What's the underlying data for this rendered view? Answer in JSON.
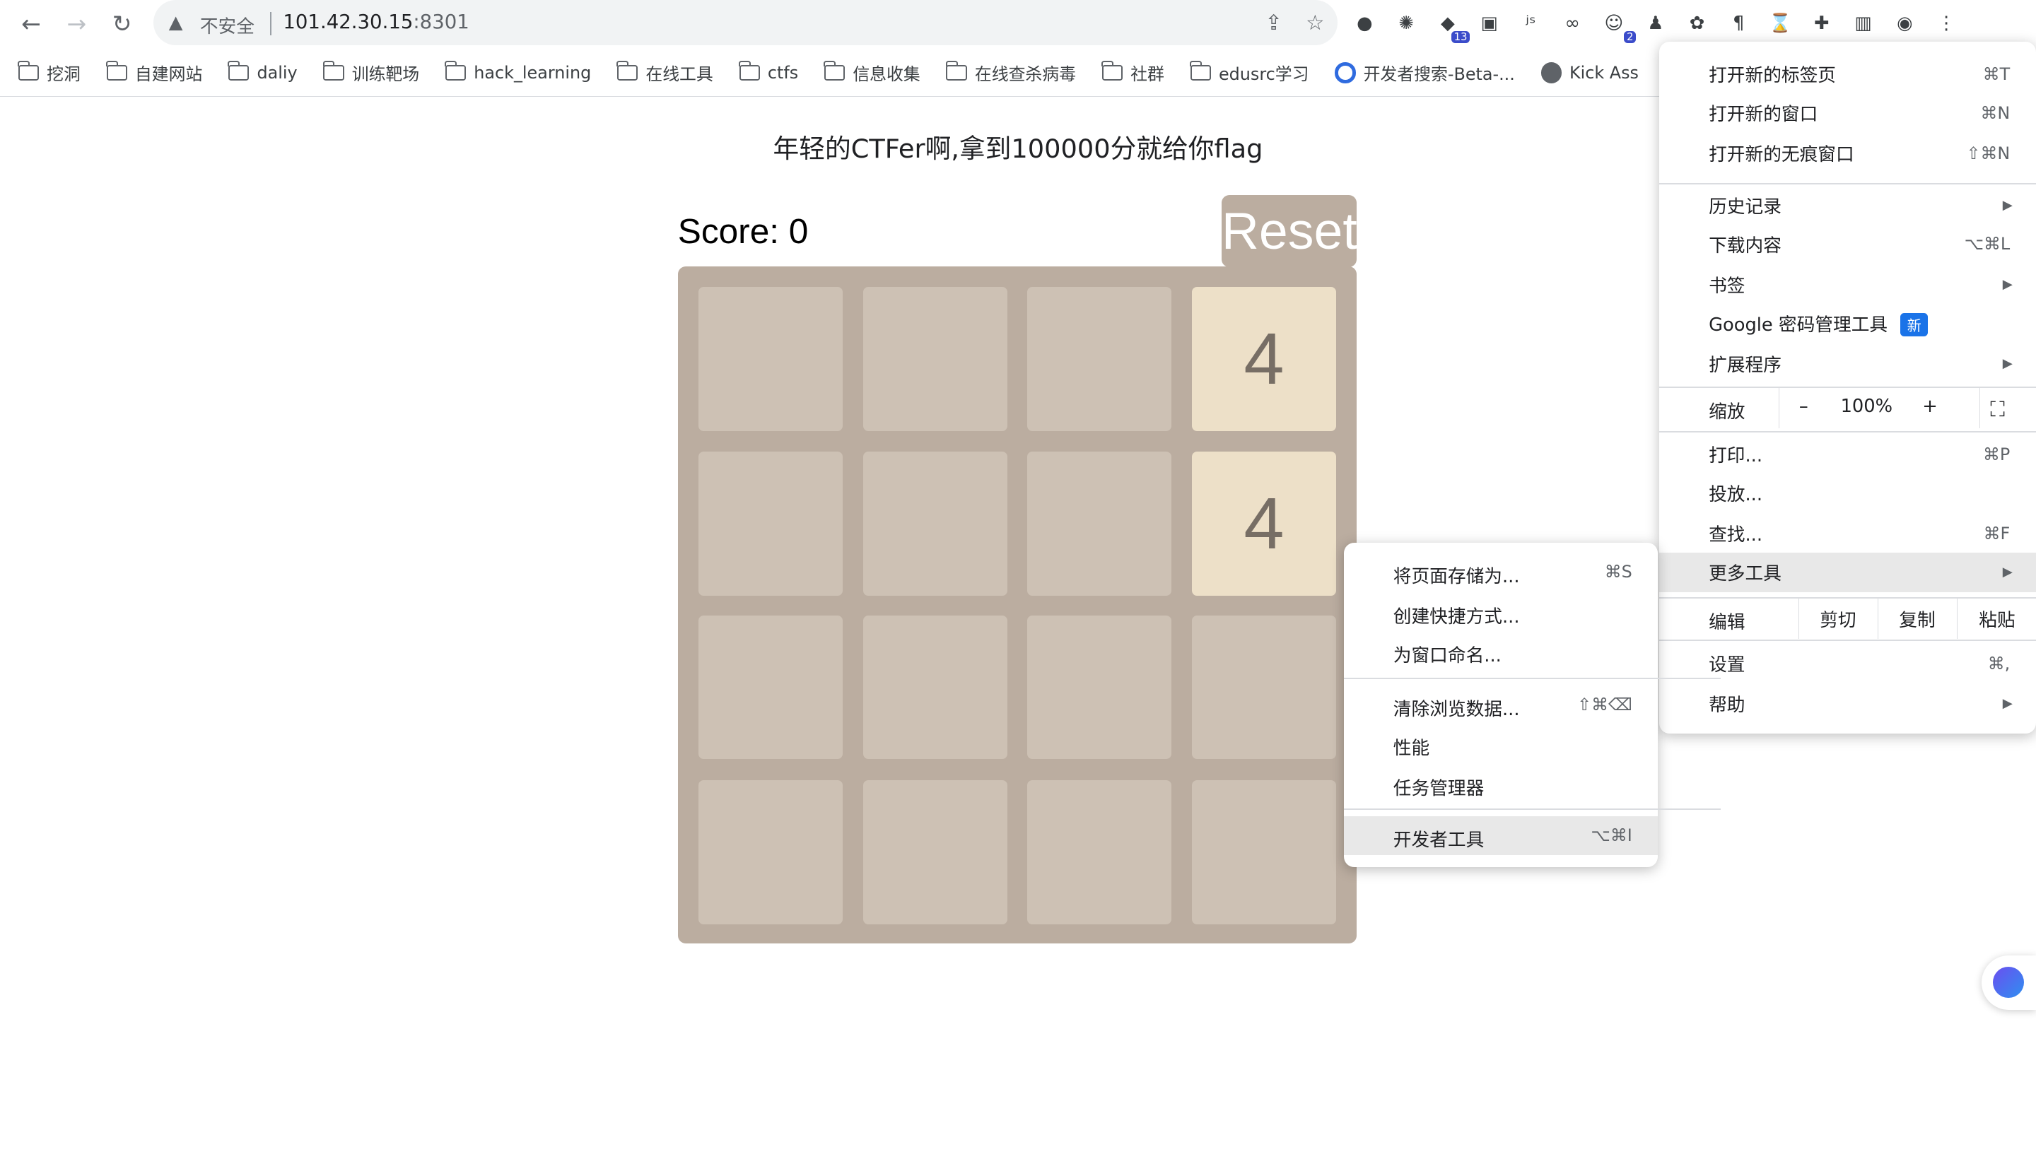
{
  "browser": {
    "security_label": "不安全",
    "url_host": "101.42.30.15",
    "url_port": ":8301",
    "extensions": [
      {
        "icon": "circle-icon",
        "badge": ""
      },
      {
        "icon": "openai-icon",
        "badge": ""
      },
      {
        "icon": "graduation-cap-icon",
        "badge": "13"
      },
      {
        "icon": "gamepad-icon",
        "badge": ""
      },
      {
        "icon": "js-icon",
        "badge": ""
      },
      {
        "icon": "link-icon",
        "badge": ""
      },
      {
        "icon": "robot-icon",
        "badge": "2"
      },
      {
        "icon": "penguin-icon",
        "badge": ""
      },
      {
        "icon": "flower-icon",
        "badge": ""
      },
      {
        "icon": "paragraph-icon",
        "badge": ""
      },
      {
        "icon": "hourglass-icon",
        "badge": ""
      },
      {
        "icon": "puzzle-icon",
        "badge": ""
      },
      {
        "icon": "sidepanel-icon",
        "badge": ""
      },
      {
        "icon": "profile-icon",
        "badge": ""
      },
      {
        "icon": "kebab-menu-icon",
        "badge": ""
      }
    ]
  },
  "bookmarks": [
    "挖洞",
    "自建网站",
    "daliy",
    "训练靶场",
    "hack_learning",
    "在线工具",
    "ctfs",
    "信息收集",
    "在线查杀病毒",
    "社群",
    "edusrc学习",
    "开发者搜索-Beta-...",
    "Kick Ass"
  ],
  "page": {
    "title": "年轻的CTFer啊,拿到100000分就给你flag",
    "score_label": "Score: 0",
    "reset_label": "Reset",
    "grid": [
      [
        "",
        "",
        "",
        "4"
      ],
      [
        "",
        "",
        "",
        "4"
      ],
      [
        "",
        "",
        "",
        ""
      ],
      [
        "",
        "",
        "",
        ""
      ]
    ]
  },
  "menu": {
    "new_tab": "打开新的标签页",
    "new_tab_sc": "⌘T",
    "new_window": "打开新的窗口",
    "new_window_sc": "⌘N",
    "incognito": "打开新的无痕窗口",
    "incognito_sc": "⇧⌘N",
    "history": "历史记录",
    "downloads": "下载内容",
    "downloads_sc": "⌥⌘L",
    "bookmarks": "书签",
    "password_manager": "Google 密码管理工具",
    "new_badge": "新",
    "extensions": "扩展程序",
    "zoom": "缩放",
    "zoom_minus": "–",
    "zoom_value": "100%",
    "zoom_plus": "+",
    "print": "打印...",
    "print_sc": "⌘P",
    "cast": "投放...",
    "find": "查找...",
    "find_sc": "⌘F",
    "more_tools": "更多工具",
    "edit": "编辑",
    "cut": "剪切",
    "copy": "复制",
    "paste": "粘贴",
    "settings": "设置",
    "settings_sc": "⌘,",
    "help": "帮助"
  },
  "submenu": {
    "save_page": "将页面存储为...",
    "save_page_sc": "⌘S",
    "create_shortcut": "创建快捷方式...",
    "name_window": "为窗口命名...",
    "clear_data": "清除浏览数据...",
    "clear_data_sc": "⇧⌘⌫",
    "performance": "性能",
    "task_manager": "任务管理器",
    "devtools": "开发者工具",
    "devtools_sc": "⌥⌘I"
  }
}
